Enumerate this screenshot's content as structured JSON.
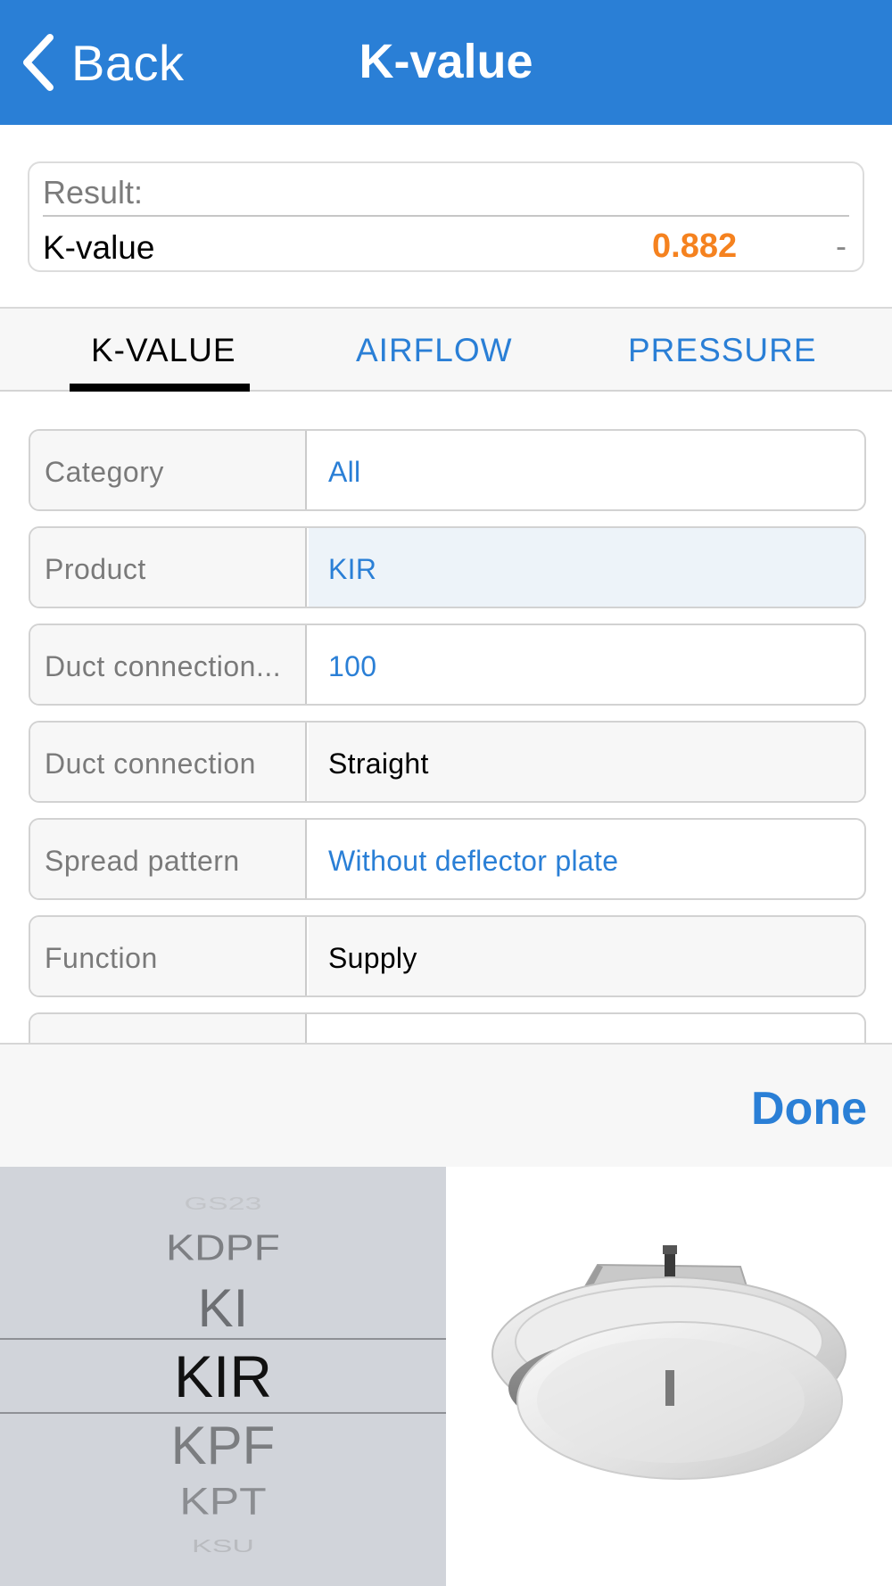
{
  "navbar": {
    "back_label": "Back",
    "title": "K-value"
  },
  "result": {
    "title": "Result:",
    "label": "K-value",
    "value": "0.882",
    "unit": "-"
  },
  "tabs": [
    {
      "label": "K-VALUE",
      "active": true
    },
    {
      "label": "AIRFLOW",
      "active": false
    },
    {
      "label": "PRESSURE",
      "active": false
    }
  ],
  "form": {
    "rows": [
      {
        "label": "Category",
        "value": "All"
      },
      {
        "label": "Product",
        "value": "KIR"
      },
      {
        "label": "Duct connection...",
        "value": "100"
      },
      {
        "label": "Duct connection",
        "value": "Straight"
      },
      {
        "label": "Spread pattern",
        "value": "Without deflector plate"
      },
      {
        "label": "Function",
        "value": "Supply"
      }
    ]
  },
  "picker": {
    "done_label": "Done",
    "options": [
      "GS23",
      "KDPF",
      "KI",
      "KIR",
      "KPF",
      "KPT",
      "KSU"
    ],
    "selected": "KIR"
  },
  "colors": {
    "navbar": "#2a7fd6",
    "link": "#2a7fd6",
    "result_value": "#f5821f"
  },
  "icons": {
    "back": "chevron-left-icon"
  }
}
